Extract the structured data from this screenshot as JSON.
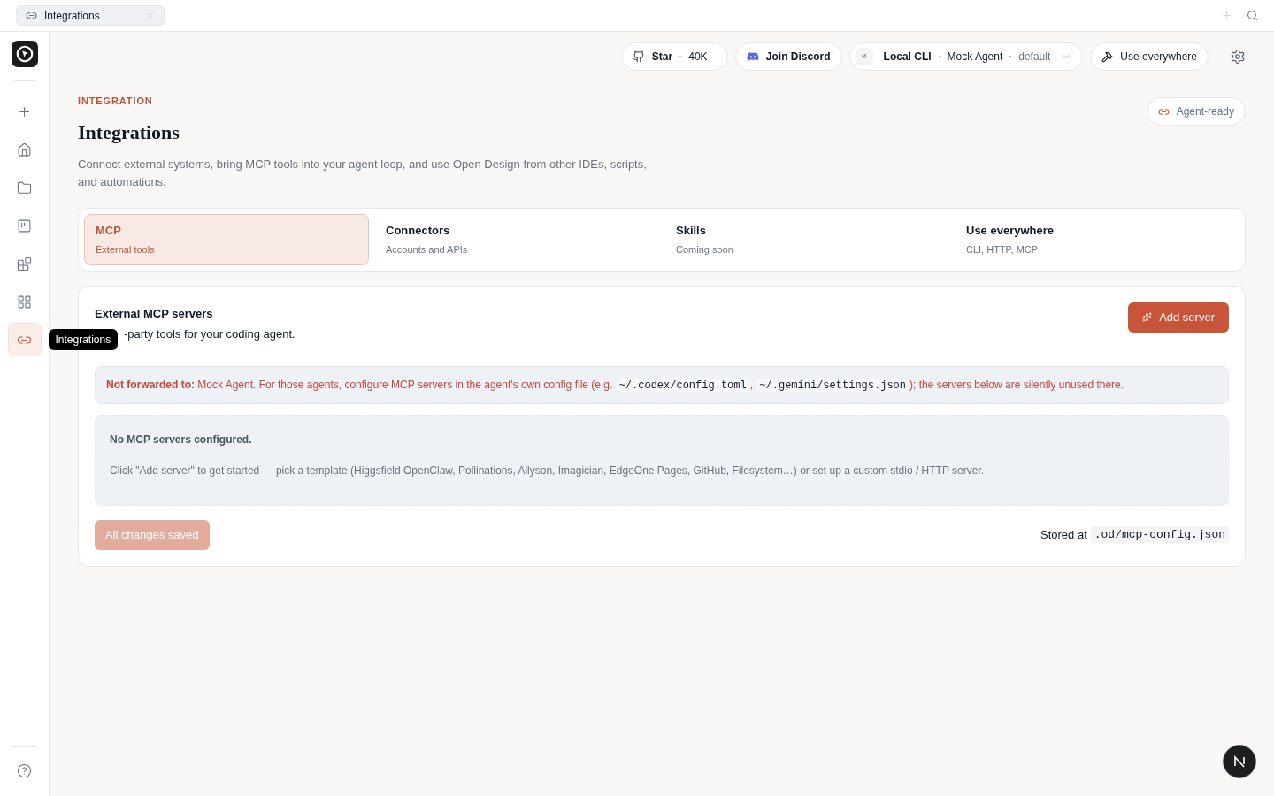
{
  "browser_tab": {
    "title": "Integrations"
  },
  "sidebar": {
    "items": [
      {
        "selected": false
      },
      {
        "selected": false
      },
      {
        "selected": false
      },
      {
        "selected": false
      },
      {
        "selected": false
      },
      {
        "selected": false
      },
      {
        "selected": true
      }
    ],
    "tooltip": "Integrations"
  },
  "header": {
    "star": {
      "label": "Star",
      "count": "40K"
    },
    "discord": "Join Discord",
    "agent": {
      "badge": "M",
      "mode": "Local CLI",
      "agent": "Mock Agent",
      "model": "default"
    },
    "use_everywhere": "Use everywhere"
  },
  "page": {
    "eyebrow": "INTEGRATION",
    "title": "Integrations",
    "description": "Connect external systems, bring MCP tools into your agent loop, and use Open Design from other IDEs, scripts, and automations.",
    "badge": "Agent-ready"
  },
  "tabs": [
    {
      "label": "MCP",
      "sub": "External tools",
      "selected": true
    },
    {
      "label": "Connectors",
      "sub": "Accounts and APIs",
      "selected": false
    },
    {
      "label": "Skills",
      "sub": "Coming soon",
      "selected": false
    },
    {
      "label": "Use everywhere",
      "sub": "CLI, HTTP, MCP",
      "selected": false
    }
  ],
  "panel": {
    "title": "External MCP servers",
    "subtitle": "-party tools for your coding agent.",
    "add_button": "Add server",
    "notice": [
      {
        "kind": "strong",
        "text": "Not forwarded to:"
      },
      {
        "kind": "text",
        "text": " Mock Agent. For those agents, configure MCP servers in the agent's own config file (e.g. "
      },
      {
        "kind": "code",
        "text": "~/.codex/config.toml"
      },
      {
        "kind": "text",
        "text": ", "
      },
      {
        "kind": "code",
        "text": "~/.gemini/settings.json"
      },
      {
        "kind": "text",
        "text": "); the servers below are silently unused there."
      }
    ],
    "empty": {
      "title": "No MCP servers configured.",
      "body": "Click \"Add server\" to get started — pick a template (Higgsfield OpenClaw, Pollinations, Allyson, Imagician, EdgeOne Pages, GitHub, Filesystem…) or set up a custom stdio / HTTP server."
    },
    "save_button": {
      "label": "All changes saved",
      "disabled": true
    },
    "stored": {
      "label": "Stored at",
      "path": ".od/mcp-config.json"
    }
  }
}
